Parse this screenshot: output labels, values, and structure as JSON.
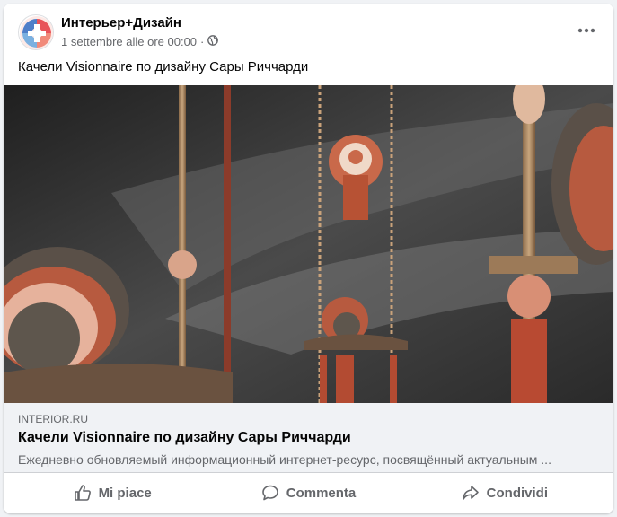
{
  "post": {
    "page_name": "Интерьер+Дизайн",
    "timestamp": "1 settembre alle ore 00:00",
    "separator": "·",
    "audience_icon": "globe-icon",
    "more_icon": "more-options-icon",
    "caption": "Качели Visionnaire по дизайну Сары Риччарди"
  },
  "link": {
    "domain": "INTERIOR.RU",
    "title": "Качели Visionnaire по дизайну Сары Риччарди",
    "description": "Ежедневно обновляемый информационный интернет-ресурс, посвящённый актуальным ..."
  },
  "actions": {
    "like_label": "Mi piace",
    "comment_label": "Commenta",
    "share_label": "Condividi"
  },
  "colors": {
    "text_primary": "#050505",
    "text_secondary": "#65676b",
    "link_bg": "#f0f2f5",
    "accent_copper": "#c9694a"
  }
}
